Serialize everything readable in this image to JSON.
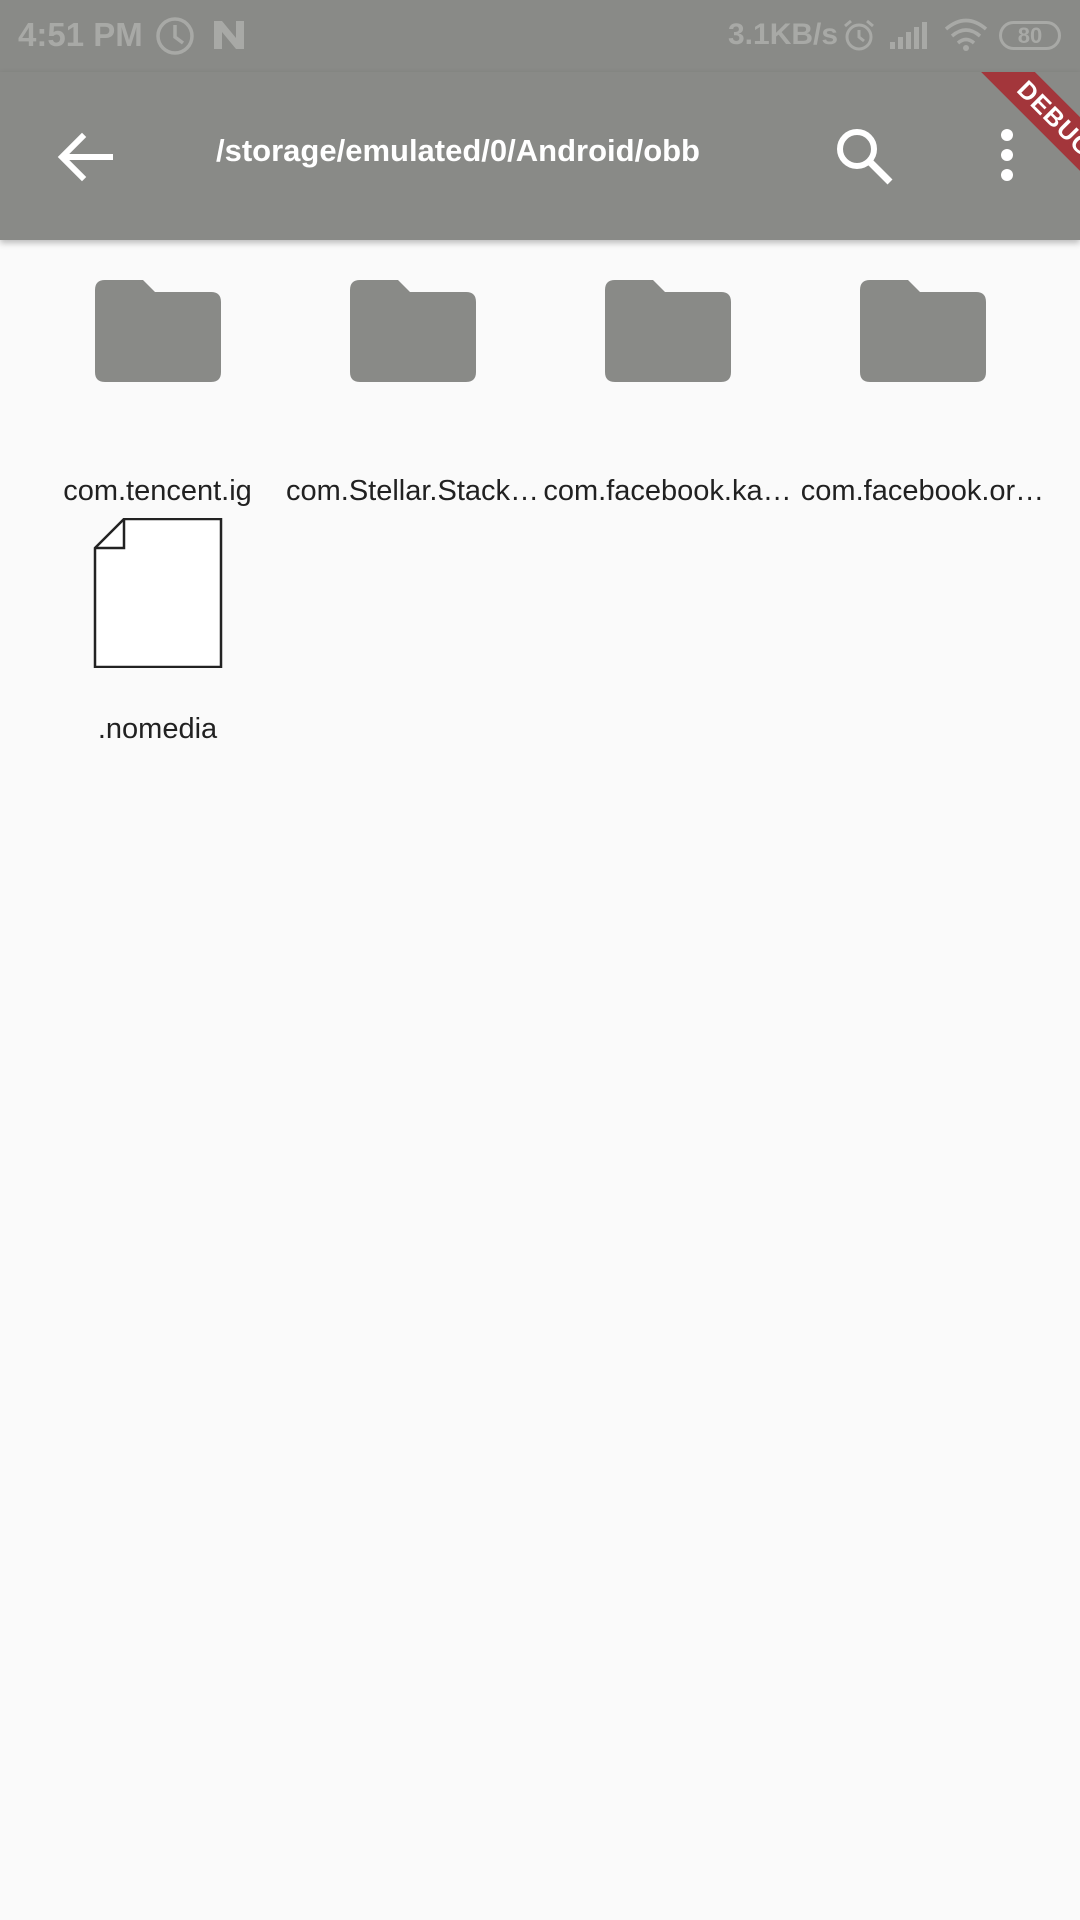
{
  "status_bar": {
    "time": "4:51 PM",
    "network_speed": "3.1KB/s",
    "battery": "80"
  },
  "app_bar": {
    "title": "/storage/emulated/0/Android/obb",
    "back_icon": "arrow-back-icon",
    "search_icon": "search-icon",
    "more_icon": "more-vert-icon"
  },
  "debug_banner": "DEBUG",
  "files": [
    {
      "name": "com.tencent.ig",
      "type": "folder"
    },
    {
      "name": "com.Stellar.Stack…",
      "type": "folder"
    },
    {
      "name": "com.facebook.ka…",
      "type": "folder"
    },
    {
      "name": "com.facebook.or…",
      "type": "folder"
    },
    {
      "name": ".nomedia",
      "type": "file"
    }
  ],
  "colors": {
    "app_bar": "#898a87",
    "folder_icon": "#898a87",
    "background": "#fafafa",
    "debug_ribbon": "#a3363b"
  }
}
